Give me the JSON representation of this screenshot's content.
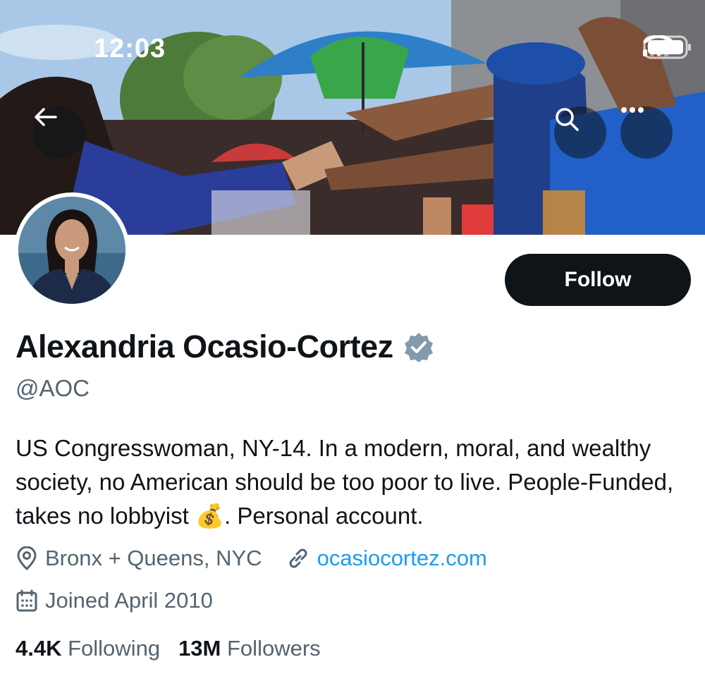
{
  "status_bar": {
    "time": "12:03"
  },
  "header": {
    "back_icon": "arrow-left-icon",
    "search_icon": "search-icon",
    "more_icon": "more-horizontal-icon"
  },
  "profile": {
    "display_name": "Alexandria Ocasio-Cortez",
    "verified": true,
    "handle": "@AOC",
    "follow_label": "Follow",
    "bio_part1": "US Congresswoman, NY-14. In a modern, moral, and wealthy society, no American should be too poor to live. People-Funded, takes no lobbyist",
    "bio_emoji": "💰",
    "bio_part2": ". Personal account.",
    "location": "Bronx + Queens, NYC",
    "website": "ocasiocortez.com",
    "joined": "Joined April 2010",
    "following_count": "4.4K",
    "following_label": "Following",
    "followers_count": "13M",
    "followers_label": "Followers"
  },
  "colors": {
    "text_primary": "#0f1419",
    "text_secondary": "#536471",
    "link": "#1d9bf0",
    "verified_badge": "#829aab"
  }
}
